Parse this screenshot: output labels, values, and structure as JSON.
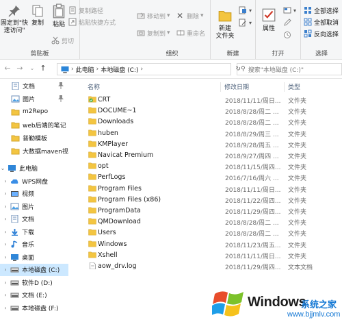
{
  "ribbon": {
    "clipboard": {
      "pin": "固定到\"快\n速访问\"",
      "copy": "复制",
      "paste": "粘贴",
      "copy_path": "复制路径",
      "paste_shortcut": "粘贴快捷方式",
      "cut": "剪切",
      "label": "剪贴板"
    },
    "organize": {
      "move_to": "移动到",
      "copy_to": "复制到",
      "delete": "删除",
      "rename": "重命名",
      "label": "组织"
    },
    "new": {
      "new_folder": "新建\n文件夹",
      "label": "新建"
    },
    "open": {
      "properties": "属性",
      "label": "打开"
    },
    "select": {
      "select_all": "全部选择",
      "select_none": "全部取消",
      "invert": "反向选择",
      "label": "选择"
    }
  },
  "address": {
    "crumbs": [
      "此电脑",
      "本地磁盘 (C:)"
    ],
    "search_placeholder": "搜索\"本地磁盘 (C:)\""
  },
  "nav": {
    "quick": [
      {
        "label": "文档"
      },
      {
        "label": "图片"
      },
      {
        "label": "m2Repo"
      },
      {
        "label": "web后端的笔记"
      },
      {
        "label": "普勤模板"
      },
      {
        "label": "大数据maven视"
      }
    ],
    "this_pc": "此电脑",
    "pc_items": [
      {
        "label": "WPS网盘"
      },
      {
        "label": "视频"
      },
      {
        "label": "图片"
      },
      {
        "label": "文档"
      },
      {
        "label": "下载"
      },
      {
        "label": "音乐"
      },
      {
        "label": "桌面"
      },
      {
        "label": "本地磁盘 (C:)"
      },
      {
        "label": "软件D (D:)"
      },
      {
        "label": "文档 (E:)"
      },
      {
        "label": "本地磁盘 (F:)"
      }
    ]
  },
  "columns": {
    "name": "名称",
    "date": "修改日期",
    "type": "类型"
  },
  "files": [
    {
      "name": "CRT",
      "date": "2018/11/11/周日...",
      "type": "文件夹",
      "kind": "special"
    },
    {
      "name": "DOCUME~1",
      "date": "2018/8/28/周二 ...",
      "type": "文件夹",
      "kind": "folder"
    },
    {
      "name": "Downloads",
      "date": "2018/8/28/周二 ...",
      "type": "文件夹",
      "kind": "folder"
    },
    {
      "name": "huben",
      "date": "2018/8/29/周三 ...",
      "type": "文件夹",
      "kind": "folder"
    },
    {
      "name": "KMPlayer",
      "date": "2018/9/28/周五 ...",
      "type": "文件夹",
      "kind": "folder"
    },
    {
      "name": "Navicat Premium",
      "date": "2018/9/27/周四 ...",
      "type": "文件夹",
      "kind": "folder"
    },
    {
      "name": "opt",
      "date": "2018/11/15/周四...",
      "type": "文件夹",
      "kind": "folder"
    },
    {
      "name": "PerfLogs",
      "date": "2016/7/16/周六 ...",
      "type": "文件夹",
      "kind": "folder"
    },
    {
      "name": "Program Files",
      "date": "2018/11/11/周日...",
      "type": "文件夹",
      "kind": "folder"
    },
    {
      "name": "Program Files (x86)",
      "date": "2018/11/22/周四...",
      "type": "文件夹",
      "kind": "folder"
    },
    {
      "name": "ProgramData",
      "date": "2018/11/29/周四...",
      "type": "文件夹",
      "kind": "folder"
    },
    {
      "name": "QMDownload",
      "date": "2018/8/28/周二 ...",
      "type": "文件夹",
      "kind": "folder"
    },
    {
      "name": "Users",
      "date": "2018/8/28/周二 ...",
      "type": "文件夹",
      "kind": "folder"
    },
    {
      "name": "Windows",
      "date": "2018/11/23/周五...",
      "type": "文件夹",
      "kind": "folder"
    },
    {
      "name": "Xshell",
      "date": "2018/11/11/周日...",
      "type": "文件夹",
      "kind": "folder"
    },
    {
      "name": "aow_drv.log",
      "date": "2018/11/29/周四...",
      "type": "文本文档",
      "kind": "file"
    }
  ],
  "watermark": {
    "title": "Windows",
    "subtitle": "系统之家",
    "url": "www.bjjmlv.com"
  },
  "colors": {
    "folder": "#f3c541",
    "selection": "#cce8ff",
    "accent": "#1478d4"
  }
}
